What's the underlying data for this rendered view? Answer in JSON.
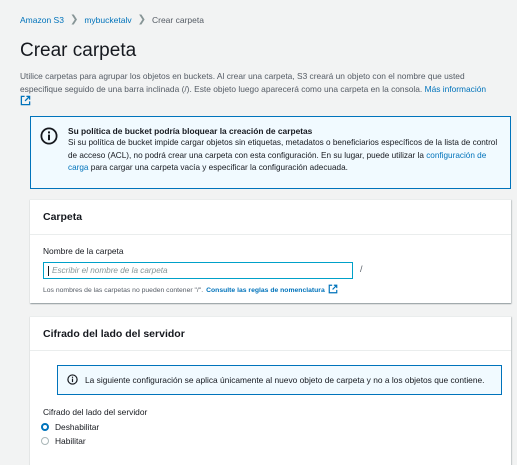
{
  "breadcrumb": {
    "items": [
      "Amazon S3",
      "mybucketalv",
      "Crear carpeta"
    ],
    "separator": ">"
  },
  "page": {
    "title": "Crear carpeta",
    "description": "Utilice carpetas para agrupar los objetos en buckets. Al crear una carpeta, S3 creará un objeto con el nombre que usted especifique seguido de una barra inclinada (/). Este objeto luego aparecerá como una carpeta en la consola.",
    "learn_more": "Más información"
  },
  "alert": {
    "title": "Su política de bucket podría bloquear la creación de carpetas",
    "body_pre": "Si su política de bucket impide cargar objetos sin etiquetas, metadatos o beneficiarios específicos de la lista de control de acceso (ACL), no podrá crear una carpeta con esta configuración. En su lugar, puede utilizar la",
    "body_link": "configuración de carga",
    "body_post": "para cargar una carpeta vacía y especificar la configuración adecuada."
  },
  "folder_panel": {
    "title": "Carpeta",
    "field_label": "Nombre de la carpeta",
    "placeholder": "Escribir el nombre de la carpeta",
    "suffix": "/",
    "constraint_text": "Los nombres de las carpetas no pueden contener \"/\".",
    "constraint_link": "Consulte las reglas de nomenclatura"
  },
  "encryption_panel": {
    "title": "Cifrado del lado del servidor",
    "info": "La siguiente configuración se aplica únicamente al nuevo objeto de carpeta y no a los objetos que contiene.",
    "field_label": "Cifrado del lado del servidor",
    "options": [
      {
        "label": "Deshabilitar",
        "selected": true
      },
      {
        "label": "Habilitar",
        "selected": false
      }
    ]
  },
  "colors": {
    "link": "#0073bb",
    "info_border": "#0073bb",
    "info_bg": "#f1faff",
    "page_bg": "#f2f3f3",
    "input_focus": "#00a1c9"
  }
}
